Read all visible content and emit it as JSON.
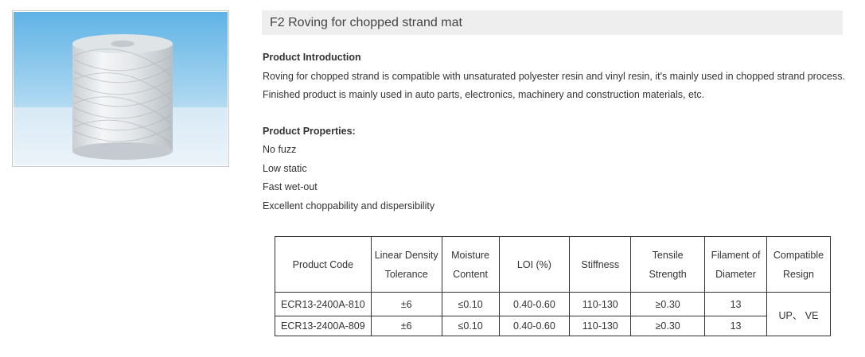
{
  "product": {
    "title": "F2 Roving for chopped strand mat",
    "image_alt": "fiberglass roving spool"
  },
  "introduction": {
    "heading": "Product Introduction",
    "text": "Roving for chopped strand is compatible with unsaturated polyester resin and vinyl resin, it's mainly used in  chopped strand process. Finished product is mainly used in auto parts, electronics, machinery and construction materials, etc."
  },
  "properties": {
    "heading": "Product Properties:",
    "items": [
      "No fuzz",
      "Low static",
      "Fast wet-out",
      "Excellent choppability and dispersibility"
    ]
  },
  "spec_table": {
    "headers": [
      "Product Code",
      "Linear Density Tolerance",
      "Moisture Content",
      "LOI (%)",
      "Stiffness",
      "Tensile Strength",
      "Filament of Diameter",
      "Compatible Resign"
    ],
    "rows": [
      [
        "ECR13-2400A-810",
        "±6",
        "≤0.10",
        "0.40-0.60",
        "110-130",
        "≥0.30",
        "13",
        "UP、 VE"
      ],
      [
        "ECR13-2400A-809",
        "±6",
        "≤0.10",
        "0.40-0.60",
        "110-130",
        "≥0.30",
        "13"
      ]
    ]
  }
}
